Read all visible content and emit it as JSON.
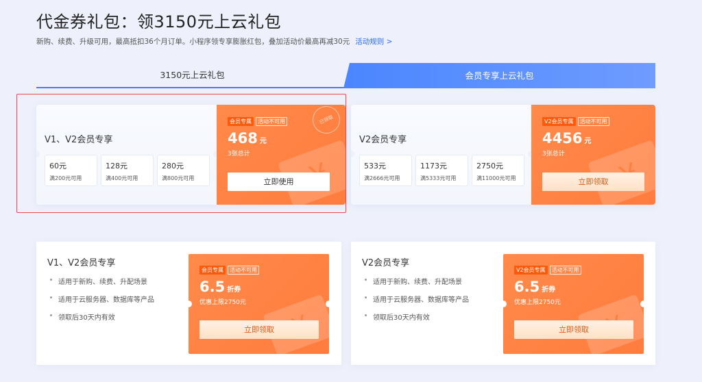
{
  "header": {
    "title": "代金券礼包：领3150元上云礼包",
    "subtitle": "新购、续费、升级可用，最高抵扣36个月订单。小程序领专享膨胀红包，叠加活动价最高再减30元",
    "rules_link": "活动规则 >"
  },
  "tabs": [
    {
      "label": "3150元上云礼包"
    },
    {
      "label": "会员专享上云礼包"
    }
  ],
  "tickets": [
    {
      "name": "V1、V2会员专享",
      "chips": [
        {
          "amount": "60元",
          "condition": "满200元可用"
        },
        {
          "amount": "128元",
          "condition": "满400元可用"
        },
        {
          "amount": "280元",
          "condition": "满800元可用"
        }
      ],
      "badge": "会员专属",
      "status": "活动不可用",
      "total": "468",
      "unit": "元",
      "note": "3张总计",
      "button": "立即使用",
      "stamp": "已领取"
    },
    {
      "name": "V2会员专享",
      "chips": [
        {
          "amount": "533元",
          "condition": "满2666元可用"
        },
        {
          "amount": "1173元",
          "condition": "满5333元可用"
        },
        {
          "amount": "2750元",
          "condition": "满11000元可用"
        }
      ],
      "badge": "V2会员专属",
      "status": "活动不可用",
      "total": "4456",
      "unit": "元",
      "note": "3张总计",
      "button": "立即领取"
    }
  ],
  "discounts": [
    {
      "name": "V1、V2会员专享",
      "features": [
        "适用于新购、续费、升配场景",
        "适用于云服务器、数据库等产品",
        "领取后30天内有效"
      ],
      "badge": "会员专属",
      "status": "活动不可用",
      "value": "6.5",
      "unit": "折券",
      "note": "优惠上限2750元",
      "button": "立即领取"
    },
    {
      "name": "V2会员专享",
      "features": [
        "适用于新购、续费、升配场景",
        "适用于云服务器、数据库等产品",
        "领取后30天内有效"
      ],
      "badge": "V2会员专属",
      "status": "活动不可用",
      "value": "6.5",
      "unit": "折券",
      "note": "优惠上限2750元",
      "button": "立即领取"
    }
  ],
  "icons": {
    "coupon_deco": "yen-ticket-icon"
  }
}
